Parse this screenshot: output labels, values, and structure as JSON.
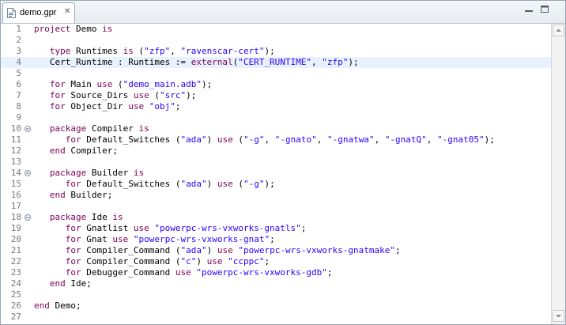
{
  "tab": {
    "title": "demo.gpr"
  },
  "icons": {
    "file": "gpr-file-icon",
    "close": "close-icon",
    "minimize": "minimize-icon",
    "maximize": "maximize-icon"
  },
  "colors": {
    "keyword": "#7f0055",
    "string": "#2a00ff",
    "current_line": "#e8f2fe",
    "line_number": "#787878"
  },
  "editor": {
    "current_line": 4,
    "folded_lines": [
      10,
      14,
      18
    ],
    "lines": [
      [
        [
          "k",
          "project"
        ],
        [
          "t",
          " Demo "
        ],
        [
          "k",
          "is"
        ]
      ],
      [],
      [
        [
          "t",
          "   "
        ],
        [
          "k",
          "type"
        ],
        [
          "t",
          " Runtimes "
        ],
        [
          "k",
          "is"
        ],
        [
          "t",
          " ("
        ],
        [
          "s",
          "\"zfp\""
        ],
        [
          "t",
          ", "
        ],
        [
          "s",
          "\"ravenscar-cert\""
        ],
        [
          "t",
          ");"
        ]
      ],
      [
        [
          "t",
          "   Cert_Runtime : Runtimes := "
        ],
        [
          "k",
          "external"
        ],
        [
          "t",
          "("
        ],
        [
          "s",
          "\"CERT_RUNTIME\""
        ],
        [
          "t",
          ", "
        ],
        [
          "s",
          "\"zfp\""
        ],
        [
          "t",
          ");"
        ]
      ],
      [],
      [
        [
          "t",
          "   "
        ],
        [
          "k",
          "for"
        ],
        [
          "t",
          " Main "
        ],
        [
          "k",
          "use"
        ],
        [
          "t",
          " ("
        ],
        [
          "s",
          "\"demo_main.adb\""
        ],
        [
          "t",
          ");"
        ]
      ],
      [
        [
          "t",
          "   "
        ],
        [
          "k",
          "for"
        ],
        [
          "t",
          " Source_Dirs "
        ],
        [
          "k",
          "use"
        ],
        [
          "t",
          " ("
        ],
        [
          "s",
          "\"src\""
        ],
        [
          "t",
          ");"
        ]
      ],
      [
        [
          "t",
          "   "
        ],
        [
          "k",
          "for"
        ],
        [
          "t",
          " Object_Dir "
        ],
        [
          "k",
          "use"
        ],
        [
          "t",
          " "
        ],
        [
          "s",
          "\"obj\""
        ],
        [
          "t",
          ";"
        ]
      ],
      [],
      [
        [
          "t",
          "   "
        ],
        [
          "k",
          "package"
        ],
        [
          "t",
          " Compiler "
        ],
        [
          "k",
          "is"
        ]
      ],
      [
        [
          "t",
          "      "
        ],
        [
          "k",
          "for"
        ],
        [
          "t",
          " Default_Switches ("
        ],
        [
          "s",
          "\"ada\""
        ],
        [
          "t",
          ") "
        ],
        [
          "k",
          "use"
        ],
        [
          "t",
          " ("
        ],
        [
          "s",
          "\"-g\""
        ],
        [
          "t",
          ", "
        ],
        [
          "s",
          "\"-gnato\""
        ],
        [
          "t",
          ", "
        ],
        [
          "s",
          "\"-gnatwa\""
        ],
        [
          "t",
          ", "
        ],
        [
          "s",
          "\"-gnatQ\""
        ],
        [
          "t",
          ", "
        ],
        [
          "s",
          "\"-gnat05\""
        ],
        [
          "t",
          ");"
        ]
      ],
      [
        [
          "t",
          "   "
        ],
        [
          "k",
          "end"
        ],
        [
          "t",
          " Compiler;"
        ]
      ],
      [],
      [
        [
          "t",
          "   "
        ],
        [
          "k",
          "package"
        ],
        [
          "t",
          " Builder "
        ],
        [
          "k",
          "is"
        ]
      ],
      [
        [
          "t",
          "      "
        ],
        [
          "k",
          "for"
        ],
        [
          "t",
          " Default_Switches ("
        ],
        [
          "s",
          "\"ada\""
        ],
        [
          "t",
          ") "
        ],
        [
          "k",
          "use"
        ],
        [
          "t",
          " ("
        ],
        [
          "s",
          "\"-g\""
        ],
        [
          "t",
          ");"
        ]
      ],
      [
        [
          "t",
          "   "
        ],
        [
          "k",
          "end"
        ],
        [
          "t",
          " Builder;"
        ]
      ],
      [],
      [
        [
          "t",
          "   "
        ],
        [
          "k",
          "package"
        ],
        [
          "t",
          " Ide "
        ],
        [
          "k",
          "is"
        ]
      ],
      [
        [
          "t",
          "      "
        ],
        [
          "k",
          "for"
        ],
        [
          "t",
          " Gnatlist "
        ],
        [
          "k",
          "use"
        ],
        [
          "t",
          " "
        ],
        [
          "s",
          "\"powerpc-wrs-vxworks-gnatls\""
        ],
        [
          "t",
          ";"
        ]
      ],
      [
        [
          "t",
          "      "
        ],
        [
          "k",
          "for"
        ],
        [
          "t",
          " Gnat "
        ],
        [
          "k",
          "use"
        ],
        [
          "t",
          " "
        ],
        [
          "s",
          "\"powerpc-wrs-vxworks-gnat\""
        ],
        [
          "t",
          ";"
        ]
      ],
      [
        [
          "t",
          "      "
        ],
        [
          "k",
          "for"
        ],
        [
          "t",
          " Compiler_Command ("
        ],
        [
          "s",
          "\"ada\""
        ],
        [
          "t",
          ") "
        ],
        [
          "k",
          "use"
        ],
        [
          "t",
          " "
        ],
        [
          "s",
          "\"powerpc-wrs-vxworks-gnatmake\""
        ],
        [
          "t",
          ";"
        ]
      ],
      [
        [
          "t",
          "      "
        ],
        [
          "k",
          "for"
        ],
        [
          "t",
          " Compiler_Command ("
        ],
        [
          "s",
          "\"c\""
        ],
        [
          "t",
          ") "
        ],
        [
          "k",
          "use"
        ],
        [
          "t",
          " "
        ],
        [
          "s",
          "\"ccppc\""
        ],
        [
          "t",
          ";"
        ]
      ],
      [
        [
          "t",
          "      "
        ],
        [
          "k",
          "for"
        ],
        [
          "t",
          " Debugger_Command "
        ],
        [
          "k",
          "use"
        ],
        [
          "t",
          " "
        ],
        [
          "s",
          "\"powerpc-wrs-vxworks-gdb\""
        ],
        [
          "t",
          ";"
        ]
      ],
      [
        [
          "t",
          "   "
        ],
        [
          "k",
          "end"
        ],
        [
          "t",
          " Ide;"
        ]
      ],
      [],
      [
        [
          "k",
          "end"
        ],
        [
          "t",
          " Demo;"
        ]
      ],
      []
    ]
  }
}
